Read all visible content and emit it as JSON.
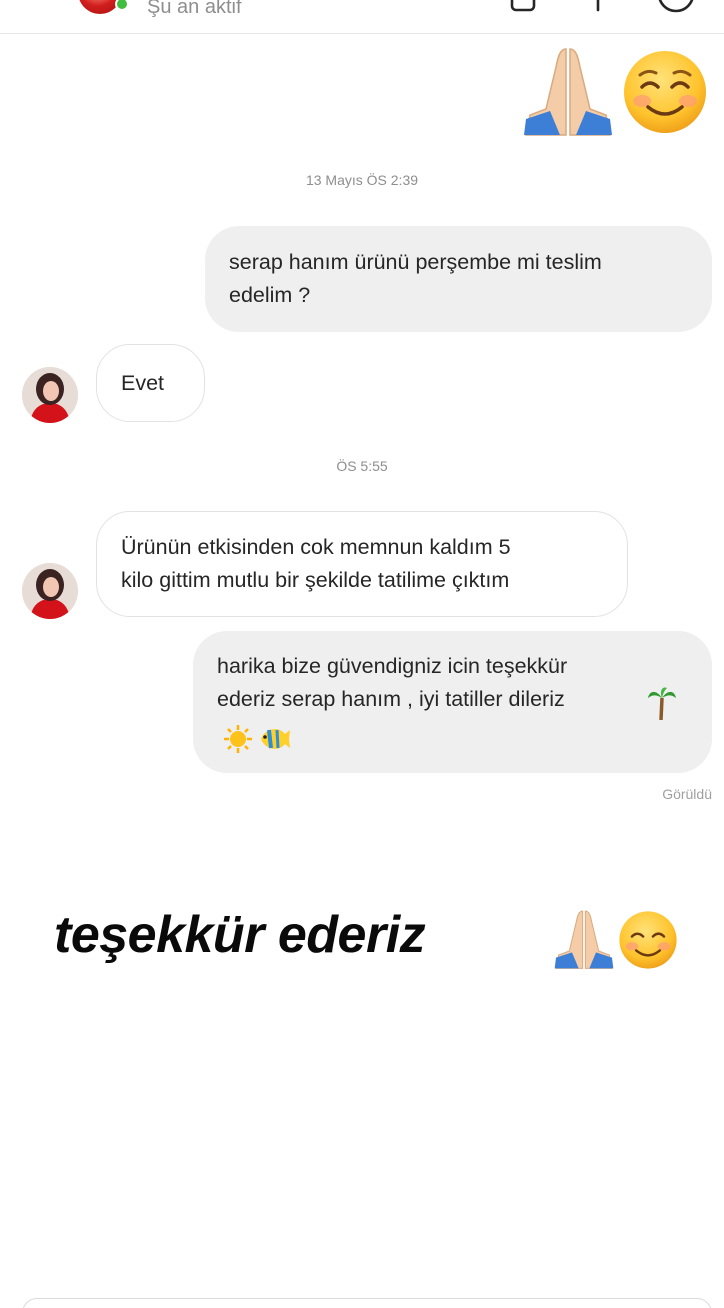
{
  "header": {
    "status": "Şu an aktif",
    "icons": [
      "back-arrow-icon",
      "video-call-icon",
      "phone-call-icon",
      "info-icon"
    ]
  },
  "messages": {
    "top_emoji": [
      "folded-hands",
      "smiling-face"
    ],
    "timestamp_1": "13 Mayıs ÖS 2:39",
    "sent_1": "serap hanım ürünü perşembe mi teslim\nedelim ?",
    "received_1": "Evet",
    "timestamp_2": "ÖS 5:55",
    "received_2": "Ürünün etkisinden cok memnun kaldım 5\nkilo gittim mutlu bir şekilde tatilime çıktım",
    "sent_2": "harika bize güvendigniz icin teşekkür\nederiz serap hanım , iyi tatiller dileriz",
    "sent_2_emoji": [
      "palm-tree",
      "sun",
      "tropical-fish"
    ],
    "seen": "Görüldü"
  },
  "caption": {
    "text": "teşekkür ederiz",
    "emoji": [
      "folded-hands",
      "smiling-face"
    ]
  },
  "colors": {
    "sent_bubble": "#efefef",
    "received_border": "#e2e2e2",
    "online": "#3fbd3f",
    "meta_text": "#8e8e8e"
  }
}
